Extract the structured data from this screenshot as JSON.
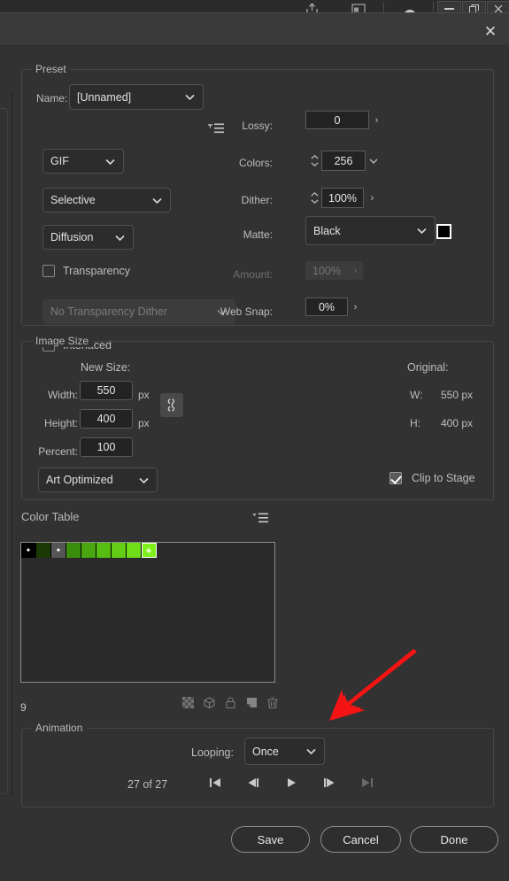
{
  "app_chrome": {
    "icons": [
      "share-icon",
      "artboard-icon",
      "cloud-icon"
    ],
    "window_buttons": [
      {
        "name": "minimize-button",
        "glyph": "—"
      },
      {
        "name": "restore-button",
        "glyph": "❐"
      },
      {
        "name": "close-button",
        "glyph": "✕"
      }
    ]
  },
  "dialog": {
    "close_label": "✕"
  },
  "preset": {
    "group_title": "Preset",
    "name_label": "Name:",
    "name_value": "[Unnamed]",
    "flyout_icon": "preset-menu-icon",
    "format_value": "GIF",
    "reduction_value": "Selective",
    "dither_algorithm_value": "Diffusion",
    "transparency_label": "Transparency",
    "transparency_checked": false,
    "transparency_dither_value": "No Transparency Dither",
    "interlaced_label": "Interlaced",
    "interlaced_checked": false,
    "lossy_label": "Lossy:",
    "lossy_value": "0",
    "colors_label": "Colors:",
    "colors_value": "256",
    "dither_label": "Dither:",
    "dither_value": "100%",
    "matte_label": "Matte:",
    "matte_value": "Black",
    "matte_color": "#000000",
    "amount_label": "Amount:",
    "amount_value": "100%",
    "web_snap_label": "Web Snap:",
    "web_snap_value": "0%"
  },
  "image_size": {
    "group_title": "Image Size",
    "new_size_label": "New Size:",
    "width_label": "Width:",
    "width_value": "550",
    "width_unit": "px",
    "height_label": "Height:",
    "height_value": "400",
    "height_unit": "px",
    "percent_label": "Percent:",
    "percent_value": "100",
    "quality_value": "Art Optimized",
    "link_icon": "chain-link-icon",
    "original_label": "Original:",
    "original_w_label": "W:",
    "original_w_value": "550 px",
    "original_h_label": "H:",
    "original_h_value": "400 px",
    "clip_to_stage_label": "Clip to Stage",
    "clip_to_stage_checked": true
  },
  "color_table": {
    "title": "Color Table",
    "flyout_icon": "color-table-menu-icon",
    "count": "9",
    "swatches": [
      {
        "color": "#000000",
        "mark": "✦",
        "selected": false
      },
      {
        "color": "#1b3a06",
        "mark": "",
        "selected": false
      },
      {
        "color": "#555555",
        "mark": "✦",
        "selected": false
      },
      {
        "color": "#3a8c0d",
        "mark": "",
        "selected": false
      },
      {
        "color": "#49a610",
        "mark": "",
        "selected": false
      },
      {
        "color": "#58bd13",
        "mark": "",
        "selected": false
      },
      {
        "color": "#63cd16",
        "mark": "",
        "selected": false
      },
      {
        "color": "#6fdd18",
        "mark": "",
        "selected": false
      },
      {
        "color": "#7ef01a",
        "mark": "◈",
        "selected": true
      }
    ],
    "tools": [
      "transparency-toggle-icon",
      "web-shift-icon",
      "lock-color-icon",
      "new-color-icon",
      "delete-color-icon"
    ]
  },
  "animation": {
    "group_title": "Animation",
    "looping_label": "Looping:",
    "looping_value": "Once",
    "frame_counter": "27 of 27",
    "controls": [
      {
        "name": "first-frame-button",
        "disabled": false
      },
      {
        "name": "previous-frame-button",
        "disabled": false
      },
      {
        "name": "play-button",
        "disabled": false
      },
      {
        "name": "next-frame-button",
        "disabled": false
      },
      {
        "name": "last-frame-button",
        "disabled": true
      }
    ]
  },
  "footer": {
    "save_label": "Save",
    "cancel_label": "Cancel",
    "done_label": "Done"
  },
  "annotation": {
    "arrow_color": "#f51414"
  }
}
